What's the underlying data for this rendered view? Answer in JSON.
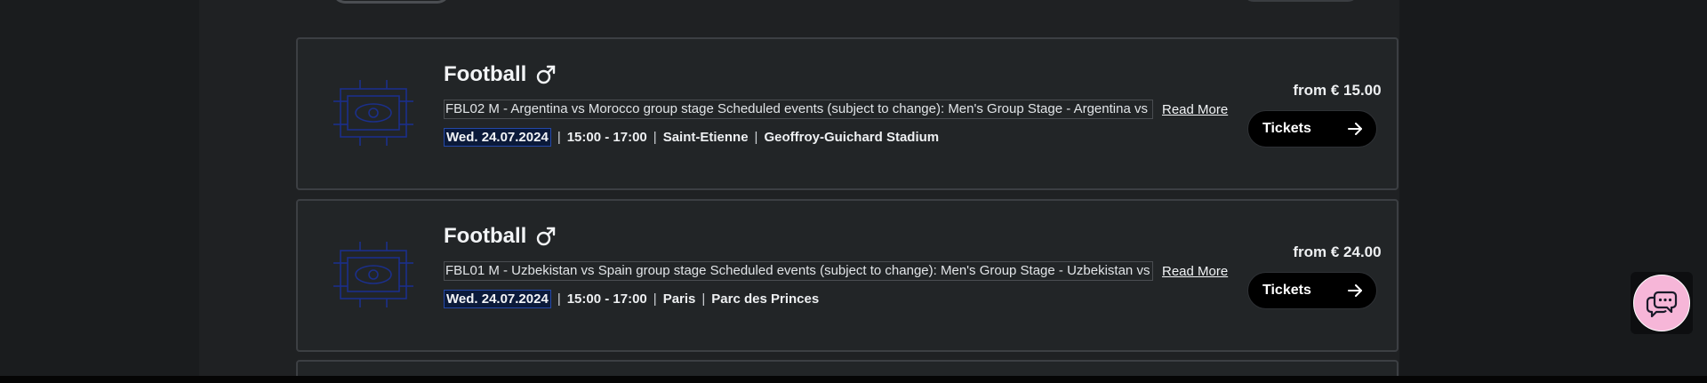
{
  "events": [
    {
      "sport": "Football",
      "gender_icon": "male-icon",
      "description": "FBL02 M - Argentina vs Morocco group stage Scheduled events (subject to change): Men's Group Stage - Argentina vs Morocco",
      "read_more": "Read More",
      "date": "Wed. 24.07.2024",
      "time": "15:00 - 17:00",
      "city": "Saint-Etienne",
      "venue": "Geoffroy-Guichard Stadium",
      "price": "from € 15.00",
      "tickets_label": "Tickets"
    },
    {
      "sport": "Football",
      "gender_icon": "male-icon",
      "description": "FBL01 M - Uzbekistan vs Spain group stage Scheduled events (subject to change): Men's Group Stage - Uzbekistan vs Spain",
      "read_more": "Read More",
      "date": "Wed. 24.07.2024",
      "time": "15:00 - 17:00",
      "city": "Paris",
      "venue": "Parc des Princes",
      "price": "from € 24.00",
      "tickets_label": "Tickets"
    }
  ],
  "separator": "|",
  "icons": {
    "card_image": "stadium-icon",
    "tickets_arrow": "arrow-right-icon",
    "chat": "chat-bubbles-icon"
  },
  "colors": {
    "page_bg": "#181a1c",
    "card_bg": "#222527",
    "chat_button": "#f6b6d8",
    "stadium_icon": "#1b2f8a",
    "date_highlight": "#2448a8"
  }
}
